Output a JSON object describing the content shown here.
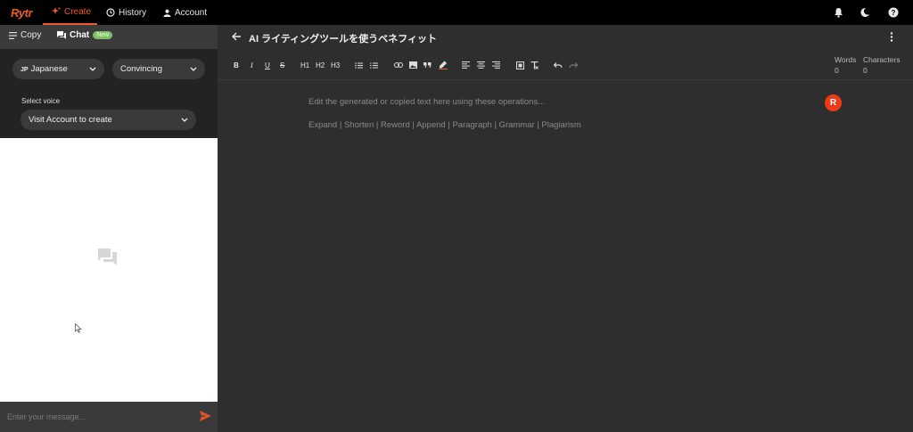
{
  "topbar": {
    "logo": "Rytr",
    "nav": [
      {
        "label": "Create",
        "icon": "sparkle-icon",
        "active": true
      },
      {
        "label": "History",
        "icon": "history-icon"
      },
      {
        "label": "Account",
        "icon": "user-icon"
      }
    ],
    "right_icons": [
      "bell-icon",
      "moon-icon",
      "help-icon"
    ]
  },
  "sidebar": {
    "tabs": [
      {
        "label": "Copy",
        "icon": "menu-icon"
      },
      {
        "label": "Chat",
        "icon": "chat-icon",
        "badge": "New",
        "active": true
      }
    ],
    "language": {
      "code": "JP",
      "value": "Japanese"
    },
    "tone": {
      "value": "Convincing"
    },
    "voice": {
      "label": "Select voice",
      "value": "Visit Account to create"
    },
    "message": {
      "placeholder": "Enter your message..."
    }
  },
  "editor": {
    "title": "AI ライティングツールを使うベネフィット",
    "toolbar": {
      "bold": "B",
      "italic": "I",
      "underline": "U",
      "strike": "S",
      "h1": "H1",
      "h2": "H2",
      "h3": "H3"
    },
    "counters": {
      "words_label": "Words",
      "words_value": "0",
      "chars_label": "Characters",
      "chars_value": "0"
    },
    "placeholder": "Edit the generated or copied text here using these operations...",
    "operations": "Expand | Shorten | Reword | Append | Paragraph | Grammar | Plagiarism",
    "avatar_letter": "R"
  },
  "colors": {
    "accent": "#f05a28",
    "avatar": "#f03a17",
    "badge": "#7fbf66"
  }
}
